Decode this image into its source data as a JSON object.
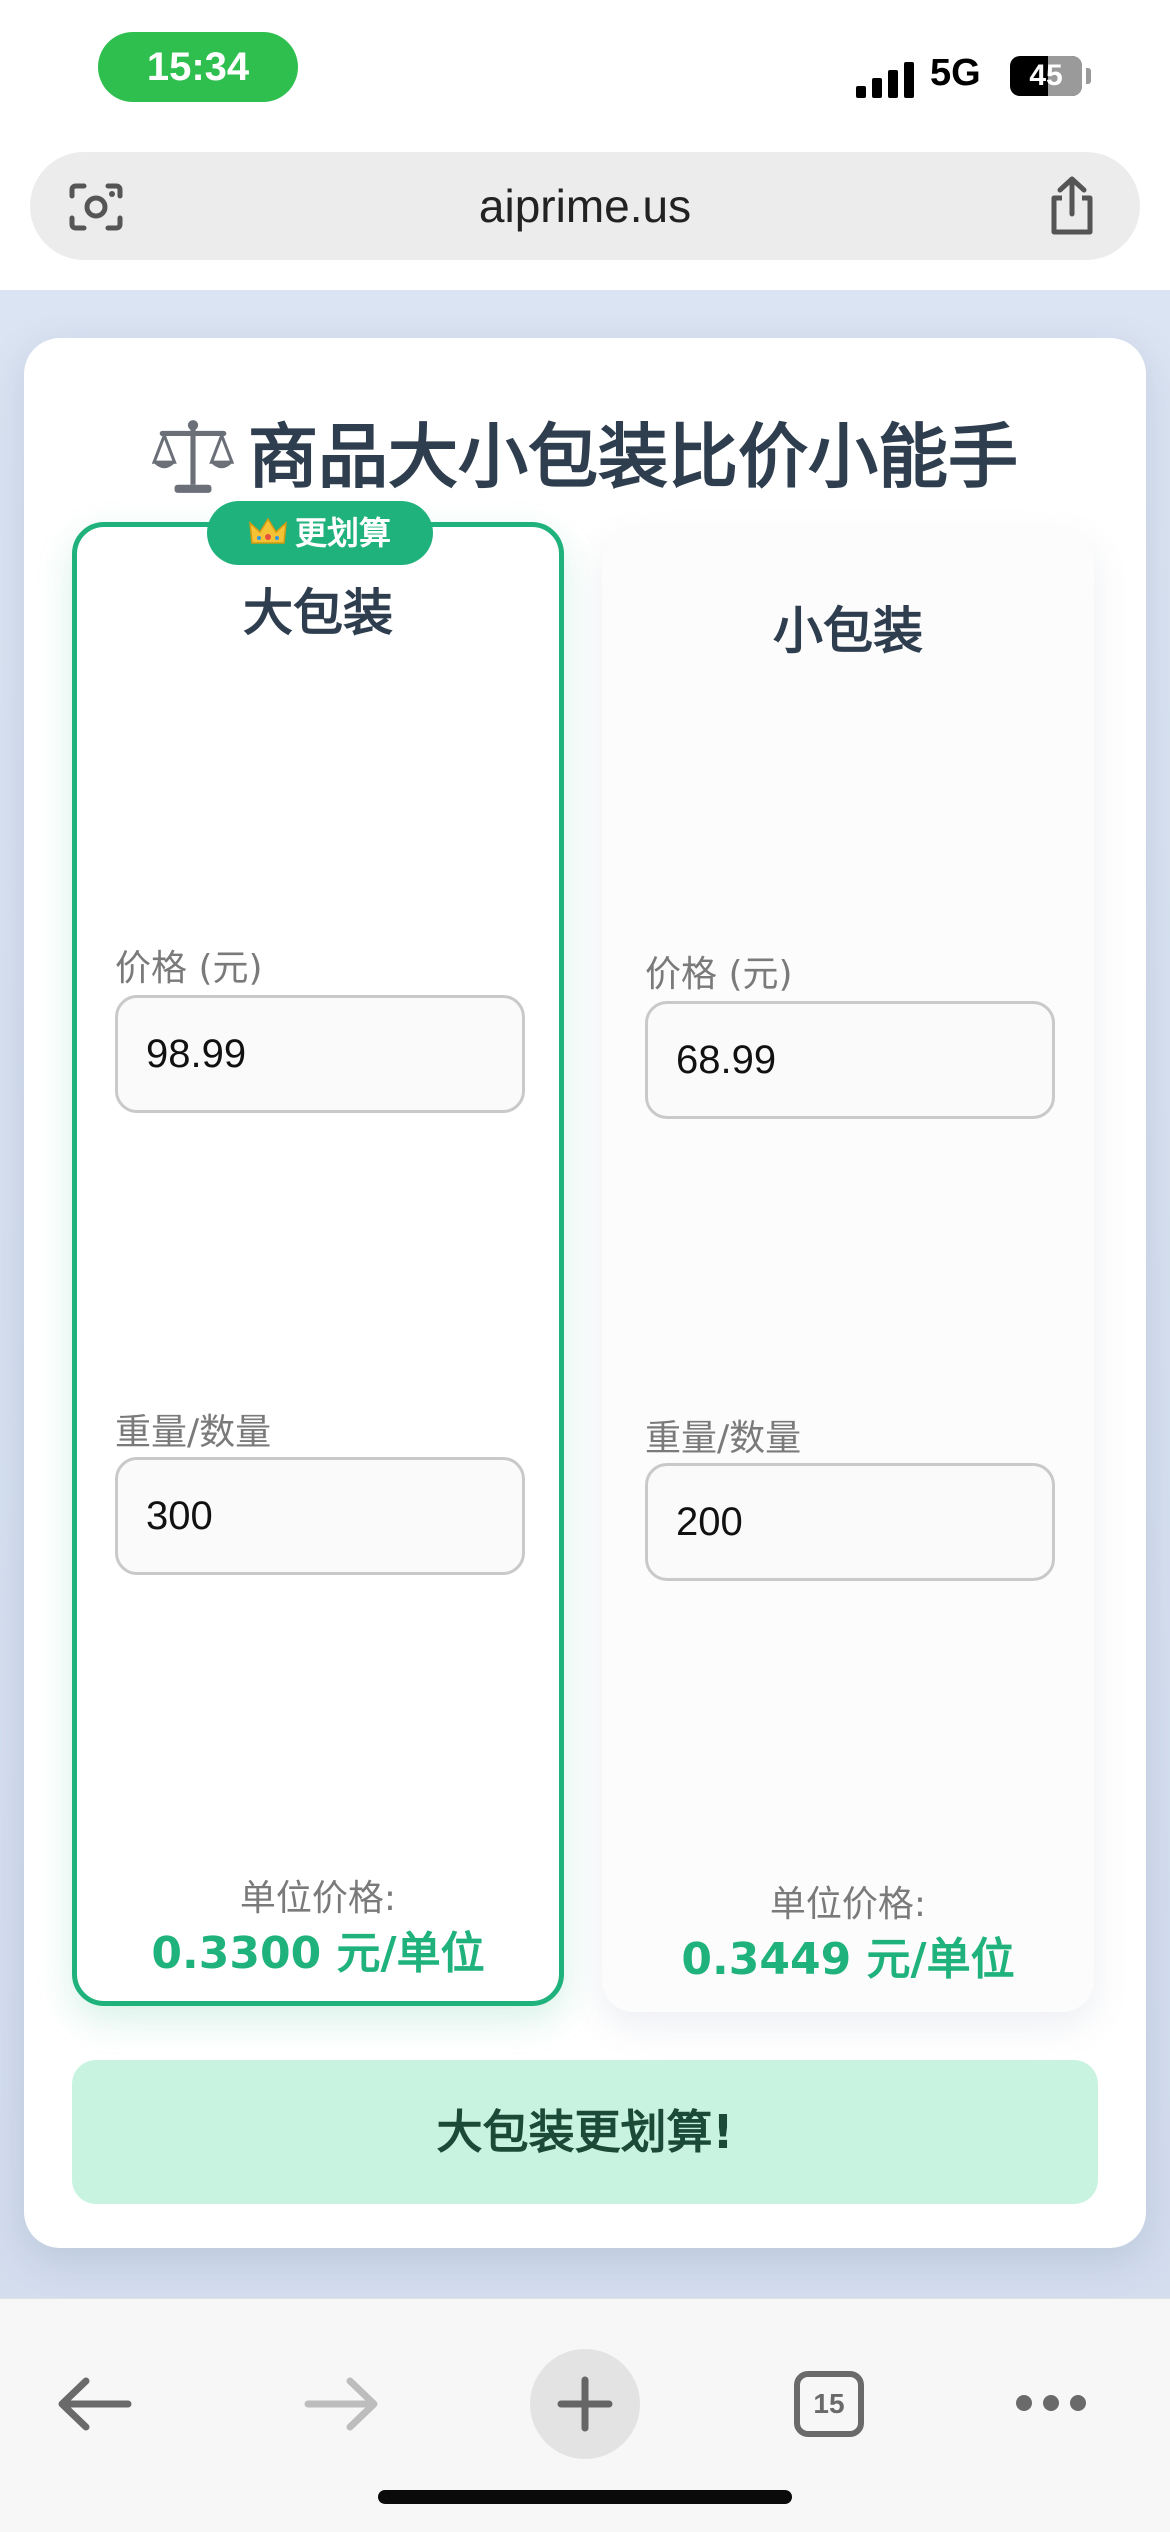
{
  "status_bar": {
    "time": "15:34",
    "network": "5G",
    "battery": "45"
  },
  "browser": {
    "url": "aiprime.us",
    "tab_count": "15"
  },
  "app": {
    "title": "商品大小包装比价小能手",
    "accent_color": "#1fb27c",
    "packages": [
      {
        "name": "大包装",
        "badge": "更划算",
        "price_label": "价格 (元)",
        "price_value": "98.99",
        "qty_label": "重量/数量",
        "qty_value": "300",
        "unit_label": "单位价格:",
        "unit_value": "0.3300 元/单位"
      },
      {
        "name": "小包装",
        "price_label": "价格 (元)",
        "price_value": "68.99",
        "qty_label": "重量/数量",
        "qty_value": "200",
        "unit_label": "单位价格:",
        "unit_value": "0.3449 元/单位"
      }
    ],
    "result": "大包装更划算!"
  },
  "icons": [
    "scale-icon",
    "crown-icon",
    "camera-scan-icon",
    "share-icon",
    "back-arrow-icon",
    "forward-arrow-icon",
    "plus-icon",
    "tabs-icon",
    "more-icon"
  ]
}
